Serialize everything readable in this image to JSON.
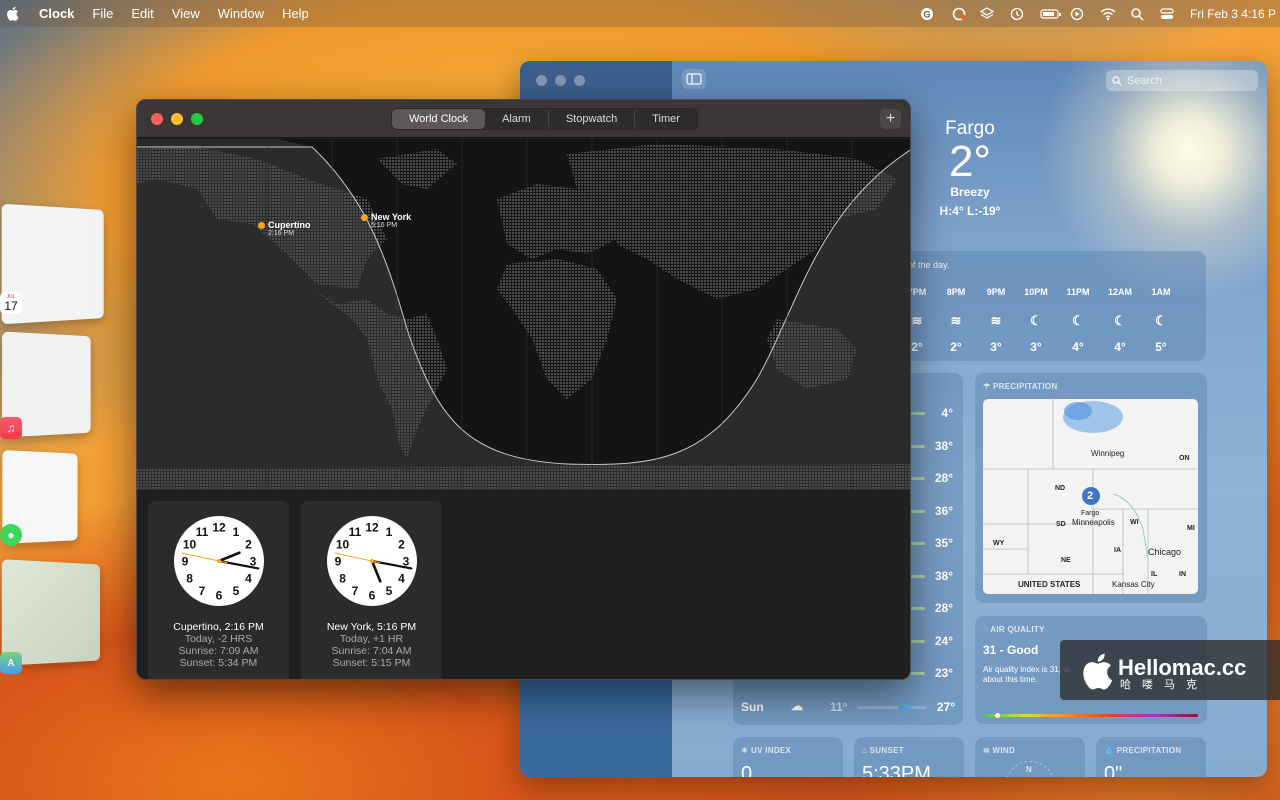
{
  "menubar": {
    "app": "Clock",
    "items": [
      "File",
      "Edit",
      "View",
      "Window",
      "Help"
    ],
    "datetime": "Fri Feb 3  4:16 P",
    "status_icons": [
      "grammarly-icon",
      "creative-cloud-icon",
      "layers-icon",
      "time-machine-icon",
      "battery-icon",
      "play-icon",
      "wifi-icon",
      "search-icon",
      "control-center-icon"
    ]
  },
  "weather": {
    "search_placeholder": "Search",
    "city": "Fargo",
    "temp": "2°",
    "condition": "Breezy",
    "hilo": "H:4°  L:-19°",
    "hourly_desc": "of the day.",
    "hours": [
      {
        "time": "7PM",
        "icon": "wind",
        "temp": "2°"
      },
      {
        "time": "8PM",
        "icon": "wind",
        "temp": "2°"
      },
      {
        "time": "9PM",
        "icon": "wind",
        "temp": "3°"
      },
      {
        "time": "10PM",
        "icon": "moon",
        "temp": "3°"
      },
      {
        "time": "11PM",
        "icon": "moon",
        "temp": "4°"
      },
      {
        "time": "12AM",
        "icon": "moon",
        "temp": "4°"
      },
      {
        "time": "1AM",
        "icon": "moon",
        "temp": "5°"
      }
    ],
    "tenday_highs": [
      "4°",
      "38°",
      "28°",
      "36°",
      "35°",
      "38°",
      "28°",
      "24°",
      "23°"
    ],
    "tenday_last": {
      "day": "Sun",
      "low": "11°",
      "high": "27°"
    },
    "precip_title": "PRECIPITATION",
    "map_labels": {
      "winnipeg": "Winnipeg",
      "on": "ON",
      "nd": "ND",
      "sd": "SD",
      "ne": "NE",
      "wy": "WY",
      "ia": "IA",
      "il": "IL",
      "in": "IN",
      "wi": "WI",
      "mi": "MI",
      "fargo": "Fargo",
      "minneapolis": "Minneapolis",
      "chicago": "Chicago",
      "us": "UNITED STATES",
      "kc": "Kansas City",
      "badge": "2"
    },
    "aq_title": "AIR QUALITY",
    "aq_value": "31 - Good",
    "aq_desc_1": "Air quality index is 31, w",
    "aq_desc_2": "about this time.",
    "uv_title": "UV INDEX",
    "uv_value": "0",
    "sunset_title": "SUNSET",
    "sunset_value": "5:33PM",
    "wind_title": "WIND",
    "wind_dir": "N",
    "precip2_title": "PRECIPITATION",
    "precip2_value": "0\""
  },
  "clock": {
    "tabs": [
      "World Clock",
      "Alarm",
      "Stopwatch",
      "Timer"
    ],
    "active_tab": "World Clock",
    "add_label": "+",
    "pins": [
      {
        "city": "Cupertino",
        "time": "2:16 PM"
      },
      {
        "city": "New York",
        "time": "5:16 PM"
      }
    ],
    "cards": [
      {
        "title": "Cupertino, 2:16 PM",
        "offset": "Today, -2 HRS",
        "sunrise": "Sunrise: 7:09 AM",
        "sunset": "Sunset: 5:34 PM",
        "hour": 2,
        "minute": 16,
        "second": 47
      },
      {
        "title": "New York, 5:16 PM",
        "offset": "Today, +1 HR",
        "sunrise": "Sunrise: 7:04 AM",
        "sunset": "Sunset: 5:15 PM",
        "hour": 5,
        "minute": 16,
        "second": 47
      }
    ]
  },
  "dock_calendar": {
    "month": "JUL",
    "day": "17"
  },
  "watermark": {
    "title": "Hellomac.cc",
    "sub": "哈　喽　马　克"
  }
}
